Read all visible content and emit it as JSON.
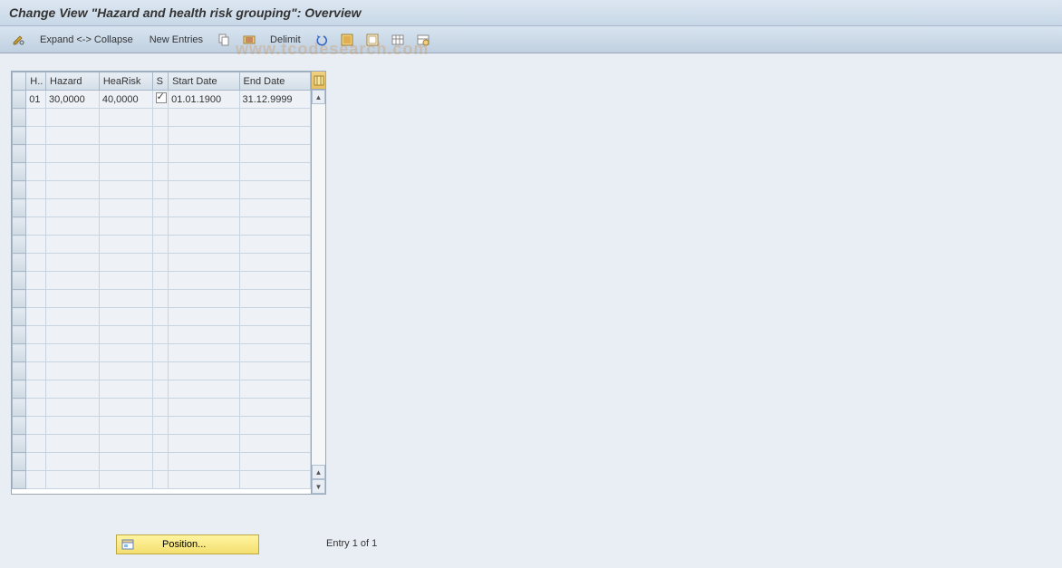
{
  "title": "Change View \"Hazard and health risk grouping\": Overview",
  "toolbar": {
    "expand_collapse": "Expand <-> Collapse",
    "new_entries": "New Entries",
    "delimit": "Delimit"
  },
  "watermark": "www.tcodesearch.com",
  "grid": {
    "columns": {
      "h": "H..",
      "hazard": "Hazard",
      "hearisk": "HeaRisk",
      "s": "S",
      "start_date": "Start Date",
      "end_date": "End Date"
    },
    "rows": [
      {
        "h": "01",
        "hazard": "30,0000",
        "hearisk": "40,0000",
        "s": true,
        "start_date": "01.01.1900",
        "end_date": "31.12.9999",
        "selected_col": "hazard"
      }
    ],
    "empty_row_count": 21
  },
  "position_button": "Position...",
  "status": "Entry 1 of 1"
}
